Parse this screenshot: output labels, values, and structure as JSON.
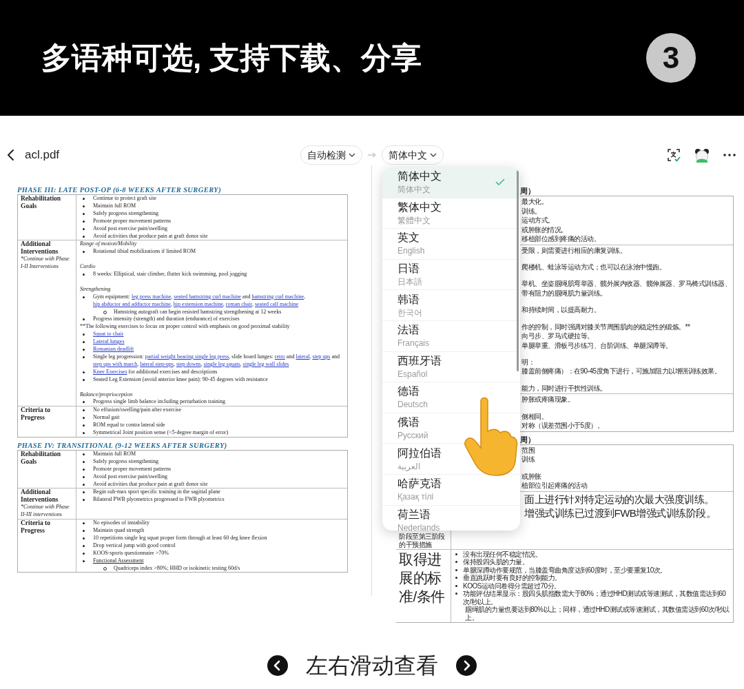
{
  "banner": {
    "title": "多语种可选, 支持下载、分享",
    "step": "3"
  },
  "app_bar": {
    "file_name": "acl.pdf",
    "source_language": "自动检测",
    "target_language": "简体中文"
  },
  "original_doc": {
    "phases": [
      {
        "title": "PHASE III: LATE POST-OP (6-8 WEEKS AFTER SURGERY)",
        "rows": [
          {
            "label": "Rehabilitation Goals",
            "items": [
              {
                "kind": "bullet",
                "text": "Continue to protect graft site"
              },
              {
                "kind": "bullet",
                "text": "Maintain full ROM"
              },
              {
                "kind": "bullet",
                "text": "Safely progress strengthening"
              },
              {
                "kind": "bullet",
                "text": "Promote proper movement patterns"
              },
              {
                "kind": "bullet",
                "text": "Avoid post exercise pain/swelling"
              },
              {
                "kind": "bullet",
                "text": "Avoid activities that produce pain at graft donor site"
              }
            ]
          },
          {
            "label": "Additional Interventions",
            "note": "*Continue with Phase I-II Interventions",
            "items": [
              {
                "kind": "heading",
                "text": "Range of motion/Mobility"
              },
              {
                "kind": "bullet",
                "text": "Rotational tibial mobilizations if limited ROM"
              },
              {
                "kind": "gap"
              },
              {
                "kind": "heading",
                "text": "Cardio"
              },
              {
                "kind": "bullet",
                "text": "8 weeks: Elliptical, stair climber, flutter kick swimming, pool jogging"
              },
              {
                "kind": "gap"
              },
              {
                "kind": "heading",
                "text": "Strengthening"
              },
              {
                "kind": "bullet",
                "parts": [
                  {
                    "text": "Gym equipment: "
                  },
                  {
                    "text": "leg press machine",
                    "kind": "link"
                  },
                  {
                    "text": ", "
                  },
                  {
                    "text": "seated hamstring curl machine",
                    "kind": "link"
                  },
                  {
                    "text": " and "
                  },
                  {
                    "text": "hamstring curl machine",
                    "kind": "link"
                  },
                  {
                    "text": ", "
                  },
                  {
                    "text": "hip abductor and adductor machine",
                    "kind": "link"
                  },
                  {
                    "text": ", "
                  },
                  {
                    "text": "hip extension machine",
                    "kind": "link"
                  },
                  {
                    "text": ", "
                  },
                  {
                    "text": "roman chair",
                    "kind": "link"
                  },
                  {
                    "text": ", "
                  },
                  {
                    "text": "seated calf machine",
                    "kind": "link"
                  }
                ]
              },
              {
                "kind": "sub",
                "text": "Hamstring autograft can begin resisted hamstring strengthening at 12 weeks"
              },
              {
                "kind": "bullet",
                "text": "Progress intensity (strength) and duration (endurance) of exercises"
              },
              {
                "kind": "note",
                "text": "**The following exercises to focus on proper control with emphasis on good proximal stability"
              },
              {
                "kind": "bullet",
                "parts": [
                  {
                    "text": "Squat to chair",
                    "kind": "link"
                  }
                ]
              },
              {
                "kind": "bullet",
                "parts": [
                  {
                    "text": "Lateral lunges",
                    "kind": "link"
                  }
                ]
              },
              {
                "kind": "bullet",
                "parts": [
                  {
                    "text": "Romanian deadlift",
                    "kind": "link"
                  }
                ]
              },
              {
                "kind": "bullet",
                "parts": [
                  {
                    "text": "Single leg progression: "
                  },
                  {
                    "text": "partial weight bearing single leg press",
                    "kind": "link"
                  },
                  {
                    "text": ", slide board lunges: "
                  },
                  {
                    "text": "retro",
                    "kind": "link"
                  },
                  {
                    "text": " and "
                  },
                  {
                    "text": "lateral",
                    "kind": "link"
                  },
                  {
                    "text": ", "
                  },
                  {
                    "text": "step ups",
                    "kind": "link"
                  },
                  {
                    "text": " and "
                  },
                  {
                    "text": "step ups with march",
                    "kind": "link"
                  },
                  {
                    "text": ", "
                  },
                  {
                    "text": "lateral step-ups",
                    "kind": "link"
                  },
                  {
                    "text": ", "
                  },
                  {
                    "text": "step downs",
                    "kind": "link"
                  },
                  {
                    "text": ", "
                  },
                  {
                    "text": "single leg squats",
                    "kind": "link"
                  },
                  {
                    "text": ", "
                  },
                  {
                    "text": "single leg wall slides",
                    "kind": "link"
                  }
                ]
              },
              {
                "kind": "bullet",
                "parts": [
                  {
                    "text": "Knee Exercises",
                    "kind": "link"
                  },
                  {
                    "text": " for additional exercises and descriptions"
                  }
                ]
              },
              {
                "kind": "bullet",
                "text": "Seated Leg Extension (avoid anterior knee pain):  90-45 degrees with resistance"
              },
              {
                "kind": "gap"
              },
              {
                "kind": "heading",
                "text": "Balance/proprioception"
              },
              {
                "kind": "bullet",
                "text": "Progress single limb balance including perturbation training"
              }
            ]
          },
          {
            "label": "Criteria to Progress",
            "items": [
              {
                "kind": "bullet",
                "text": "No effusion/swelling/pain after exercise"
              },
              {
                "kind": "bullet",
                "text": "Normal gait"
              },
              {
                "kind": "bullet",
                "text": "ROM equal to contra lateral side"
              },
              {
                "kind": "bullet",
                "text": "Symmetrical Joint position sense (<5-degree margin of error)"
              }
            ]
          }
        ]
      },
      {
        "title": "PHASE IV: TRANSITIONAL (9-12 WEEKS AFTER SURGERY)",
        "rows": [
          {
            "label": "Rehabilitation Goals",
            "items": [
              {
                "kind": "bullet",
                "text": "Maintain full ROM"
              },
              {
                "kind": "bullet",
                "text": "Safely progress strengthening"
              },
              {
                "kind": "bullet",
                "text": "Promote proper movement patterns"
              },
              {
                "kind": "bullet",
                "text": "Avoid post exercise pain/swelling"
              },
              {
                "kind": "bullet",
                "text": "Avoid activities that produce pain at graft donor site"
              }
            ]
          },
          {
            "label": "Additional Interventions",
            "note": "*Continue with Phase II-III interventions",
            "items": [
              {
                "kind": "bullet",
                "text": "Begin sub-max sport specific training in the sagittal plane"
              },
              {
                "kind": "bullet",
                "text": "Bilateral PWB plyometrics progressed to FWB plyometrics"
              }
            ]
          },
          {
            "label": "Criteria to Progress",
            "items": [
              {
                "kind": "bullet",
                "text": "No episodes of instability"
              },
              {
                "kind": "bullet",
                "text": "Maintain quad strength"
              },
              {
                "kind": "bullet",
                "text": "10 repetitions single leg squat proper form through at least 60 deg knee flexion"
              },
              {
                "kind": "bullet",
                "text": "Drop vertical jump with good control"
              },
              {
                "kind": "bullet",
                "text": "KOOS-sports questionnaire >70%"
              },
              {
                "kind": "bullet",
                "parts": [
                  {
                    "text": "Functional Assessment",
                    "kind": "underline"
                  }
                ]
              },
              {
                "kind": "sub",
                "text": "Quadriceps index >80%; HHD or isokinetic testing 60d/s"
              }
            ]
          }
        ]
      }
    ]
  },
  "translated_doc": {
    "sections": [
      {
        "title": "周）",
        "rows": [
          {
            "items": [
              {
                "kind": "line",
                "text": "最大化。"
              },
              {
                "kind": "line",
                "text": "训练。"
              },
              {
                "kind": "line",
                "text": "运动方式。"
              },
              {
                "kind": "line",
                "text": "或肿胀的情况。"
              },
              {
                "kind": "line",
                "text": "移植部位感到疼痛的活动。"
              }
            ]
          },
          {
            "items": [
              {
                "kind": "line",
                "text": "受限，则需要进行相应的康复训练。"
              },
              {
                "kind": "gap"
              },
              {
                "kind": "line",
                "text": "爬楼机、蛙泳等运动方式；也可以在泳池中慢跑。"
              },
              {
                "kind": "gap"
              },
              {
                "kind": "line",
                "text": "举机、坐姿腘绳肌弯举器、髋外展内收器、髋伸展器、罗马椅式训练器、"
              },
              {
                "kind": "line",
                "text": "带有阻力的腘绳肌力量训练。"
              },
              {
                "kind": "gap"
              },
              {
                "kind": "line",
                "text": "和持续时间，以提高耐力。"
              },
              {
                "kind": "gap"
              },
              {
                "kind": "line",
                "text": "作的控制，同时强调对膝关节周围肌肉的稳定性的锻炼。**"
              },
              {
                "kind": "line",
                "text": "向弓步、罗马式硬拉等。"
              },
              {
                "kind": "line",
                "text": "单腿举重、滑板弓步练习、台阶训练、单腿深蹲等。"
              },
              {
                "kind": "gap"
              },
              {
                "kind": "line",
                "text": "明："
              },
              {
                "kind": "line",
                "text": "膝盖前侧疼痛）：在90-45度角下进行，可施加阻力以增强训练效果。"
              },
              {
                "kind": "gap"
              },
              {
                "kind": "line",
                "text": "能力，同时进行干扰性训练。"
              }
            ]
          },
          {
            "items": [
              {
                "kind": "line",
                "text": "肿胀或疼痛现象。"
              },
              {
                "kind": "gap"
              },
              {
                "kind": "line",
                "text": "侧相同。"
              },
              {
                "kind": "line",
                "text": "对称（误差范围小于5度）。"
              }
            ]
          }
        ]
      },
      {
        "title": "周）",
        "rows": [
          {
            "items": [
              {
                "kind": "line",
                "text": "范围"
              },
              {
                "kind": "line",
                "text": "训练"
              },
              {
                "kind": "gap"
              },
              {
                "kind": "line",
                "text": "或肿胀"
              },
              {
                "kind": "line",
                "text": "植部位引起疼痛的活动"
              }
            ]
          },
          {
            "label": "阶段至第三阶段的干预措施",
            "kind": "small",
            "items": [
              {
                "kind": "large",
                "text": "面上进行针对特定运动的次最大强度训练。"
              },
              {
                "kind": "large",
                "text": "增强式训练已过渡到FWB增强式训练阶段。"
              }
            ]
          },
          {
            "label": "取得进展的标准/条件",
            "kind": "large",
            "items": [
              {
                "kind": "bullet",
                "text": "没有出现任何不稳定情况。"
              },
              {
                "kind": "bullet",
                "text": "保持股四头肌的力量。"
              },
              {
                "kind": "bullet",
                "text": "单腿深蹲动作要规范，当膝盖弯曲角度达到60度时，至少要重复10次。"
              },
              {
                "kind": "bullet",
                "text": "垂直跳跃时要有良好的控制能力。"
              },
              {
                "kind": "bullet",
                "text": "KOOS运动问卷得分需超过70分。"
              },
              {
                "kind": "bullet",
                "text": "功能评估结果显示：股四头肌指数需大于80%；通过HHD测试或等速测试，其数值需达到60次/秒以上。"
              },
              {
                "kind": "line",
                "text": "腘绳肌的力量也要达到80%以上；同样，通过HHD测试或等速测试，其数值需达到60次/秒以上。"
              }
            ]
          }
        ]
      }
    ]
  },
  "language_menu": {
    "items": [
      {
        "name": "简体中文",
        "native": "简体中文",
        "selected": true
      },
      {
        "name": "繁体中文",
        "native": "繁體中文",
        "selected": false
      },
      {
        "name": "英文",
        "native": "English",
        "selected": false
      },
      {
        "name": "日语",
        "native": "日本語",
        "selected": false
      },
      {
        "name": "韩语",
        "native": "한국어",
        "selected": false
      },
      {
        "name": "法语",
        "native": "Français",
        "selected": false
      },
      {
        "name": "西班牙语",
        "native": "Español",
        "selected": false
      },
      {
        "name": "德语",
        "native": "Deutsch",
        "selected": false
      },
      {
        "name": "俄语",
        "native": "Русский",
        "selected": false
      },
      {
        "name": "阿拉伯语",
        "native": "العربية",
        "selected": false
      },
      {
        "name": "哈萨克语",
        "native": "Қазақ тілі",
        "selected": false
      },
      {
        "name": "荷兰语",
        "native": "Nederlands",
        "selected": false
      }
    ]
  },
  "footer": {
    "hint": "左右滑动查看"
  }
}
